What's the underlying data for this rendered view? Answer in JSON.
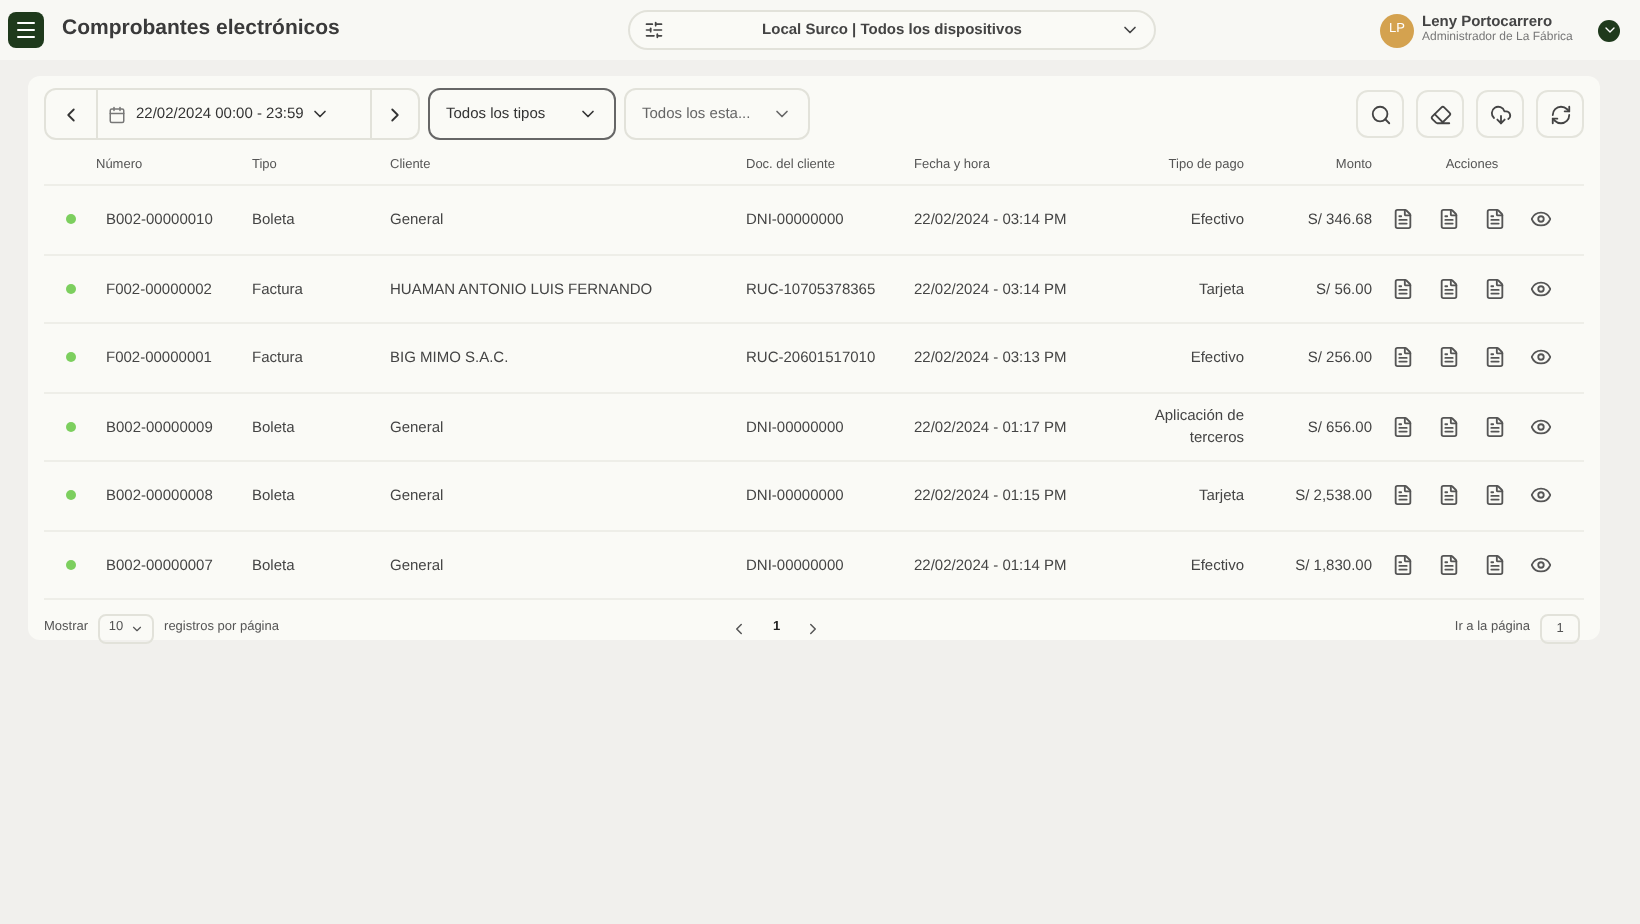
{
  "header": {
    "title": "Comprobantes electrónicos",
    "location": "Local Surco | Todos los dispositivos",
    "user": {
      "initials": "LP",
      "name": "Leny Portocarrero",
      "role": "Administrador de La Fábrica"
    }
  },
  "filters": {
    "date_range": "22/02/2024 00:00 - 23:59",
    "type": "Todos los tipos",
    "status": "Todos los esta..."
  },
  "table": {
    "columns": [
      "Número",
      "Tipo",
      "Cliente",
      "Doc. del cliente",
      "Fecha y hora",
      "Tipo de pago",
      "Monto",
      "Acciones"
    ],
    "rows": [
      {
        "color": "#7ccf5e",
        "number": "B002-00000010",
        "type": "Boleta",
        "client": "General",
        "doc": "DNI-00000000",
        "date": "22/02/2024 - 03:14 PM",
        "payment": "Efectivo",
        "amount": "S/ 346.68"
      },
      {
        "color": "#7ccf5e",
        "number": "F002-00000002",
        "type": "Factura",
        "client": "HUAMAN ANTONIO LUIS FERNANDO",
        "doc": "RUC-10705378365",
        "date": "22/02/2024 - 03:14 PM",
        "payment": "Tarjeta",
        "amount": "S/ 56.00"
      },
      {
        "color": "#7ccf5e",
        "number": "F002-00000001",
        "type": "Factura",
        "client": "BIG MIMO S.A.C.",
        "doc": "RUC-20601517010",
        "date": "22/02/2024 - 03:13 PM",
        "payment": "Efectivo",
        "amount": "S/ 256.00"
      },
      {
        "color": "#7ccf5e",
        "number": "B002-00000009",
        "type": "Boleta",
        "client": "General",
        "doc": "DNI-00000000",
        "date": "22/02/2024 - 01:17 PM",
        "payment": "Aplicación de terceros",
        "amount": "S/ 656.00"
      },
      {
        "color": "#7ccf5e",
        "number": "B002-00000008",
        "type": "Boleta",
        "client": "General",
        "doc": "DNI-00000000",
        "date": "22/02/2024 - 01:15 PM",
        "payment": "Tarjeta",
        "amount": "S/ 2,538.00"
      },
      {
        "color": "#7ccf5e",
        "number": "B002-00000007",
        "type": "Boleta",
        "client": "General",
        "doc": "DNI-00000000",
        "date": "22/02/2024 - 01:14 PM",
        "payment": "Efectivo",
        "amount": "S/ 1,830.00"
      }
    ]
  },
  "pagination": {
    "show_label": "Mostrar",
    "per_page": "10",
    "per_page_label": "registros por página",
    "pages": [
      {
        "label": "1",
        "selected": true
      }
    ],
    "goto_label": "Ir a la página",
    "goto_value": "1"
  }
}
